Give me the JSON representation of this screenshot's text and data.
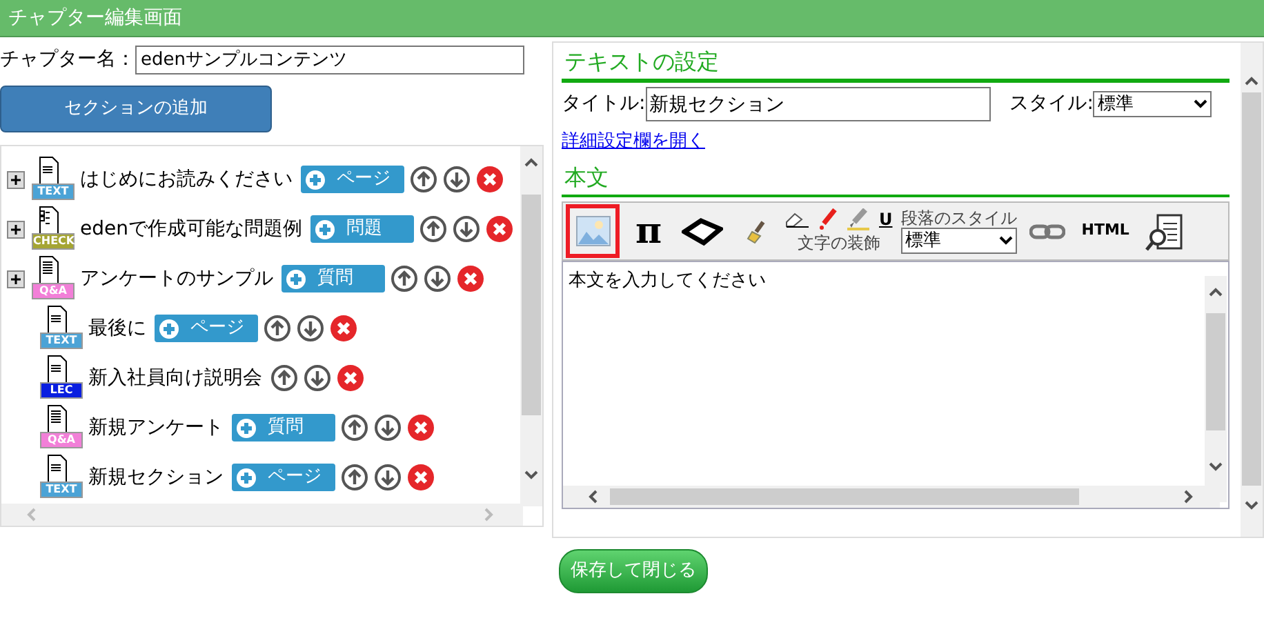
{
  "window": {
    "title": "チャプター編集画面"
  },
  "chapter": {
    "label": "チャプター名：",
    "value": "edenサンプルコンテンツ"
  },
  "add_section_button": "セクションの追加",
  "sections": [
    {
      "title": "はじめにお読みください",
      "kind": "text",
      "tag": "TEXT",
      "color": "#4ba3d6",
      "has_children": true,
      "add_label": "ページ"
    },
    {
      "title": "edenで作成可能な問題例",
      "kind": "check",
      "tag": "CHECK",
      "color": "#a5a533",
      "has_children": true,
      "add_label": "問題"
    },
    {
      "title": "アンケートのサンプル",
      "kind": "qa",
      "tag": "Q&A",
      "color": "#f27fd8",
      "has_children": true,
      "add_label": "質問"
    },
    {
      "title": "最後に",
      "kind": "text",
      "tag": "TEXT",
      "color": "#4ba3d6",
      "has_children": false,
      "add_label": "ページ"
    },
    {
      "title": "新入社員向け説明会",
      "kind": "lec",
      "tag": "LEC",
      "color": "#0a1fe0",
      "has_children": false
    },
    {
      "title": "新規アンケート",
      "kind": "qa",
      "tag": "Q&A",
      "color": "#f27fd8",
      "has_children": false,
      "add_label": "質問"
    },
    {
      "title": "新規セクション",
      "kind": "text",
      "tag": "TEXT",
      "color": "#4ba3d6",
      "has_children": false,
      "add_label": "ページ"
    }
  ],
  "text_settings": {
    "heading": "テキストの設定",
    "title_label": "タイトル:",
    "title_value": "新規セクション",
    "style_label": "スタイル:",
    "style_value": "標準",
    "details_link": "詳細設定欄を開く",
    "body_heading": "本文"
  },
  "toolbar": [
    {
      "kind": "image",
      "selected": true
    },
    {
      "kind": "pi",
      "label": "π",
      "selected": false
    },
    {
      "kind": "shape",
      "selected": false
    },
    {
      "kind": "brush",
      "selected": false
    },
    {
      "kind": "decoration",
      "underline": "U",
      "caption": "文字の装飾"
    },
    {
      "kind": "paragraph",
      "label": "段落のスタイル",
      "value": "標準"
    },
    {
      "kind": "link",
      "selected": false
    },
    {
      "kind": "html",
      "label": "HTML",
      "selected": false
    },
    {
      "kind": "preview",
      "selected": false
    }
  ],
  "editor": {
    "value": "本文を入力してください"
  },
  "save_button": "保存して閉じる"
}
